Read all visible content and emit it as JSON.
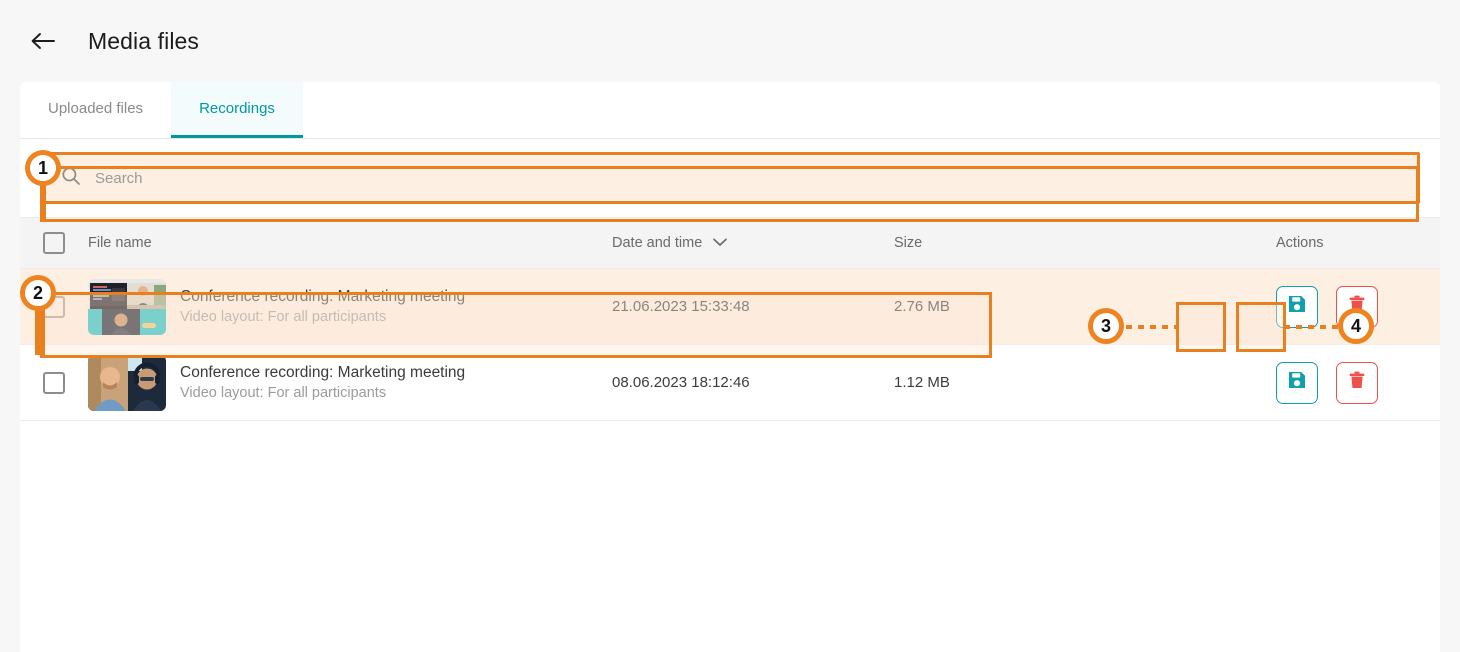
{
  "header": {
    "title": "Media files",
    "back_icon": "arrow-left-icon"
  },
  "tabs": [
    {
      "label": "Uploaded files",
      "active": false
    },
    {
      "label": "Recordings",
      "active": true
    }
  ],
  "search": {
    "placeholder": "Search",
    "value": "",
    "icon": "search-icon"
  },
  "table": {
    "columns": [
      {
        "key": "checkbox",
        "label": ""
      },
      {
        "key": "name",
        "label": "File name"
      },
      {
        "key": "date",
        "label": "Date and time",
        "sort_icon": "chevron-down-icon"
      },
      {
        "key": "size",
        "label": "Size"
      },
      {
        "key": "actions",
        "label": "Actions"
      }
    ],
    "rows": [
      {
        "title": "Conference recording: Marketing meeting",
        "subtitle": "Video layout: For all participants",
        "date": "21.06.2023 15:33:48",
        "size": "2.76 MB",
        "thumbnail": "video-grid-four-participants",
        "selected": false,
        "highlighted": true,
        "actions": [
          {
            "name": "save-button",
            "icon": "floppy-disk-icon",
            "highlighted": true
          },
          {
            "name": "delete-button",
            "icon": "trash-icon",
            "highlighted": true
          }
        ]
      },
      {
        "title": "Conference recording: Marketing meeting",
        "subtitle": "Video layout: For all participants",
        "date": "08.06.2023 18:12:46",
        "size": "1.12 MB",
        "thumbnail": "video-grid-two-participants",
        "selected": false,
        "highlighted": false,
        "actions": [
          {
            "name": "save-button",
            "icon": "floppy-disk-icon",
            "highlighted": false
          },
          {
            "name": "delete-button",
            "icon": "trash-icon",
            "highlighted": false
          }
        ]
      }
    ]
  },
  "annotations": [
    {
      "number": "1",
      "target": "search-field"
    },
    {
      "number": "2",
      "target": "first-recording-row"
    },
    {
      "number": "3",
      "target": "save-button-row-1"
    },
    {
      "number": "4",
      "target": "delete-button-row-1"
    }
  ],
  "colors": {
    "accent_teal": "#0098a6",
    "annotation_orange": "#e8801f",
    "highlight_fill": "#fdf0e3",
    "delete_red": "#f0504a",
    "save_teal": "#10a0ad"
  }
}
